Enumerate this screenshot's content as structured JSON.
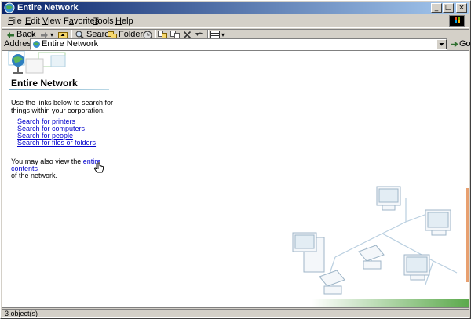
{
  "window": {
    "title": "Entire Network"
  },
  "menu": [
    {
      "label": "File",
      "accel": "F"
    },
    {
      "label": "Edit",
      "accel": "E"
    },
    {
      "label": "View",
      "accel": "V"
    },
    {
      "label": "Favorites",
      "accel": "a"
    },
    {
      "label": "Tools",
      "accel": "T"
    },
    {
      "label": "Help",
      "accel": "H"
    }
  ],
  "toolbar": {
    "back_label": "Back",
    "search_label": "Search",
    "folders_label": "Folders"
  },
  "address": {
    "label": "Address",
    "value": "Entire Network",
    "go_label": "Go"
  },
  "content": {
    "heading": "Entire Network",
    "intro": "Use the links below to search for things within your corporation.",
    "links": [
      "Search for printers",
      "Search for computers",
      "Search for people",
      "Search for files or folders"
    ],
    "also_prefix": "You may also view the ",
    "also_link": "entire contents",
    "also_suffix": "of the network."
  },
  "status": {
    "text": "3 object(s)"
  },
  "colors": {
    "title_start": "#0a246a",
    "title_end": "#a6caf0",
    "link": "#0000cc",
    "chrome": "#d4d0c8"
  }
}
